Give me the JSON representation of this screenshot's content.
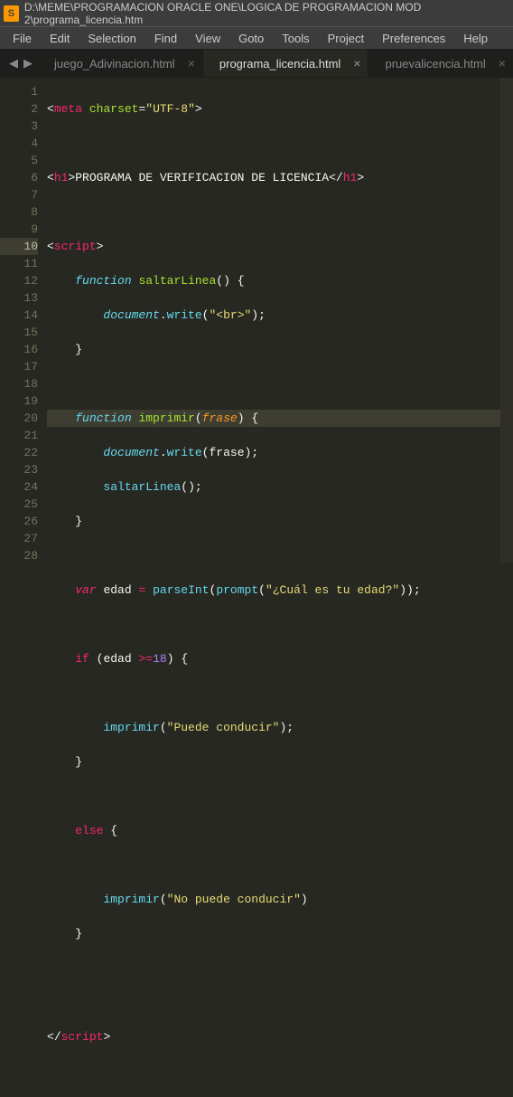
{
  "title_bar": {
    "path": "D:\\MEME\\PROGRAMACION ORACLE ONE\\LOGICA DE PROGRAMACION MOD 2\\programa_licencia.htm"
  },
  "app_glyph": "S",
  "menu": {
    "file": "File",
    "edit": "Edit",
    "selection": "Selection",
    "find": "Find",
    "view": "View",
    "goto": "Goto",
    "tools": "Tools",
    "project": "Project",
    "preferences": "Preferences",
    "help": "Help"
  },
  "nav": {
    "left": "◀",
    "right": "▶"
  },
  "tabs": [
    {
      "label": "juego_Adivinacion.html",
      "active": false
    },
    {
      "label": "programa_licencia.html",
      "active": true
    },
    {
      "label": "pruevalicencia.html",
      "active": false
    }
  ],
  "close_glyph": "×",
  "lines": {
    "n1": "1",
    "n2": "2",
    "n3": "3",
    "n4": "4",
    "n5": "5",
    "n6": "6",
    "n7": "7",
    "n8": "8",
    "n9": "9",
    "n10": "10",
    "n11": "11",
    "n12": "12",
    "n13": "13",
    "n14": "14",
    "n15": "15",
    "n16": "16",
    "n17": "17",
    "n18": "18",
    "n19": "19",
    "n20": "20",
    "n21": "21",
    "n22": "22",
    "n23": "23",
    "n24": "24",
    "n25": "25",
    "n26": "26",
    "n27": "27",
    "n28": "28"
  },
  "tok": {
    "lt": "<",
    "gt": ">",
    "sl": "/",
    "eq": "=",
    "lp": "(",
    "rp": ")",
    "lb": "{",
    "rb": "}",
    "dot": ".",
    "sc": ";",
    "ge": ">=",
    "meta": "meta",
    "charset": "charset",
    "utf": "\"UTF-8\"",
    "h1": "h1",
    "h1text": "PROGRAMA DE VERIFICACION DE LICENCIA",
    "script": "script",
    "function": "function",
    "saltarLinea": "saltarLinea",
    "imprimir": "imprimir",
    "frase": "frase",
    "document": "document",
    "write": "write",
    "br": "\"<br>\"",
    "var": "var",
    "edad": "edad",
    "parseInt": "parseInt",
    "prompt": "prompt",
    "edadq": "\"¿Cuál es tu edad?\"",
    "if": "if",
    "else": "else",
    "n18": "18",
    "puede": "\"Puede conducir\"",
    "nopuede": "\"No puede conducir\""
  }
}
